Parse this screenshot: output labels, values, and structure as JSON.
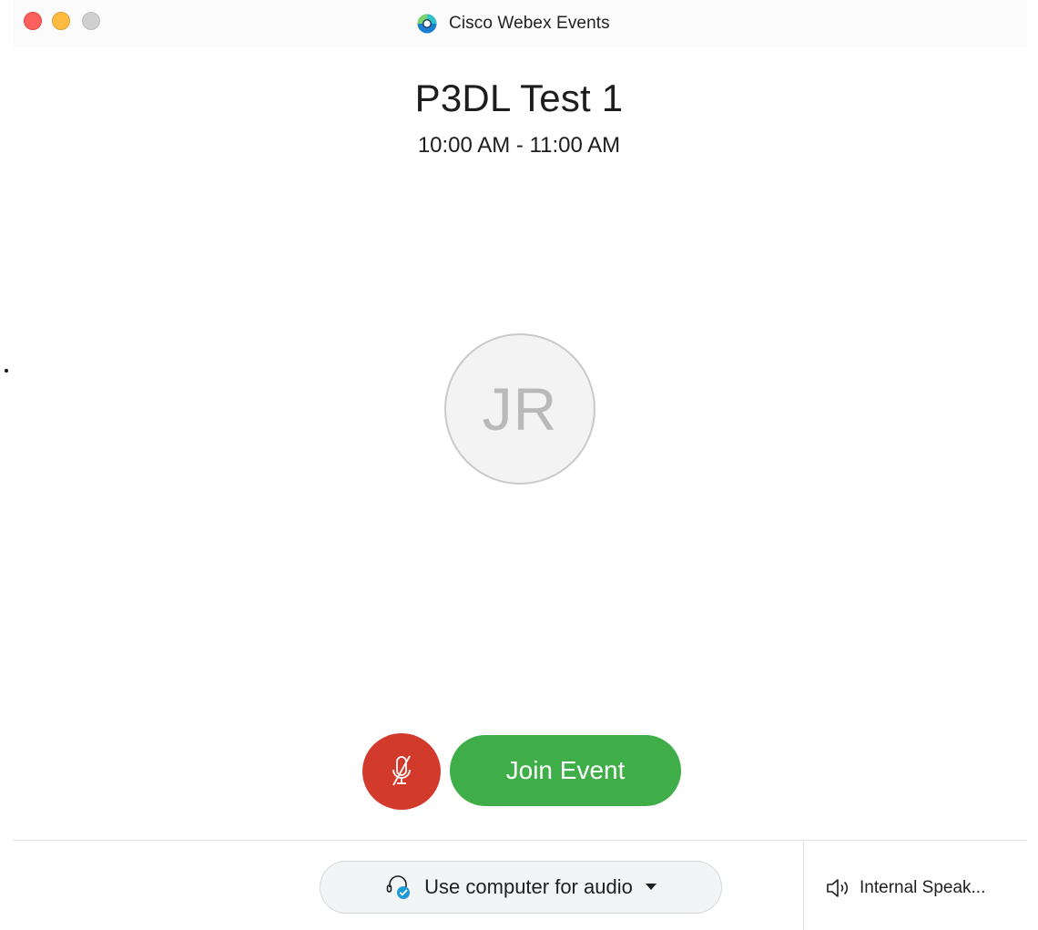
{
  "window": {
    "app_title": "Cisco Webex Events",
    "app_icon": "webex-events-logo-icon",
    "traffic_lights": [
      "close",
      "minimize",
      "zoom"
    ]
  },
  "meeting": {
    "title": "P3DL Test 1",
    "time": "10:00 AM - 11:00 AM"
  },
  "avatar": {
    "initials": "JR"
  },
  "controls": {
    "mute_icon": "microphone-muted-icon",
    "join_label": "Join Event"
  },
  "footer": {
    "audio_icon": "headset-check-icon",
    "audio_label": "Use computer for audio",
    "audio_caret": "caret-down-icon",
    "speaker_icon": "speaker-icon",
    "speaker_label": "Internal Speak..."
  },
  "colors": {
    "mute_red": "#d23a2c",
    "join_green": "#3fae49",
    "check_blue": "#1f9ad6"
  }
}
